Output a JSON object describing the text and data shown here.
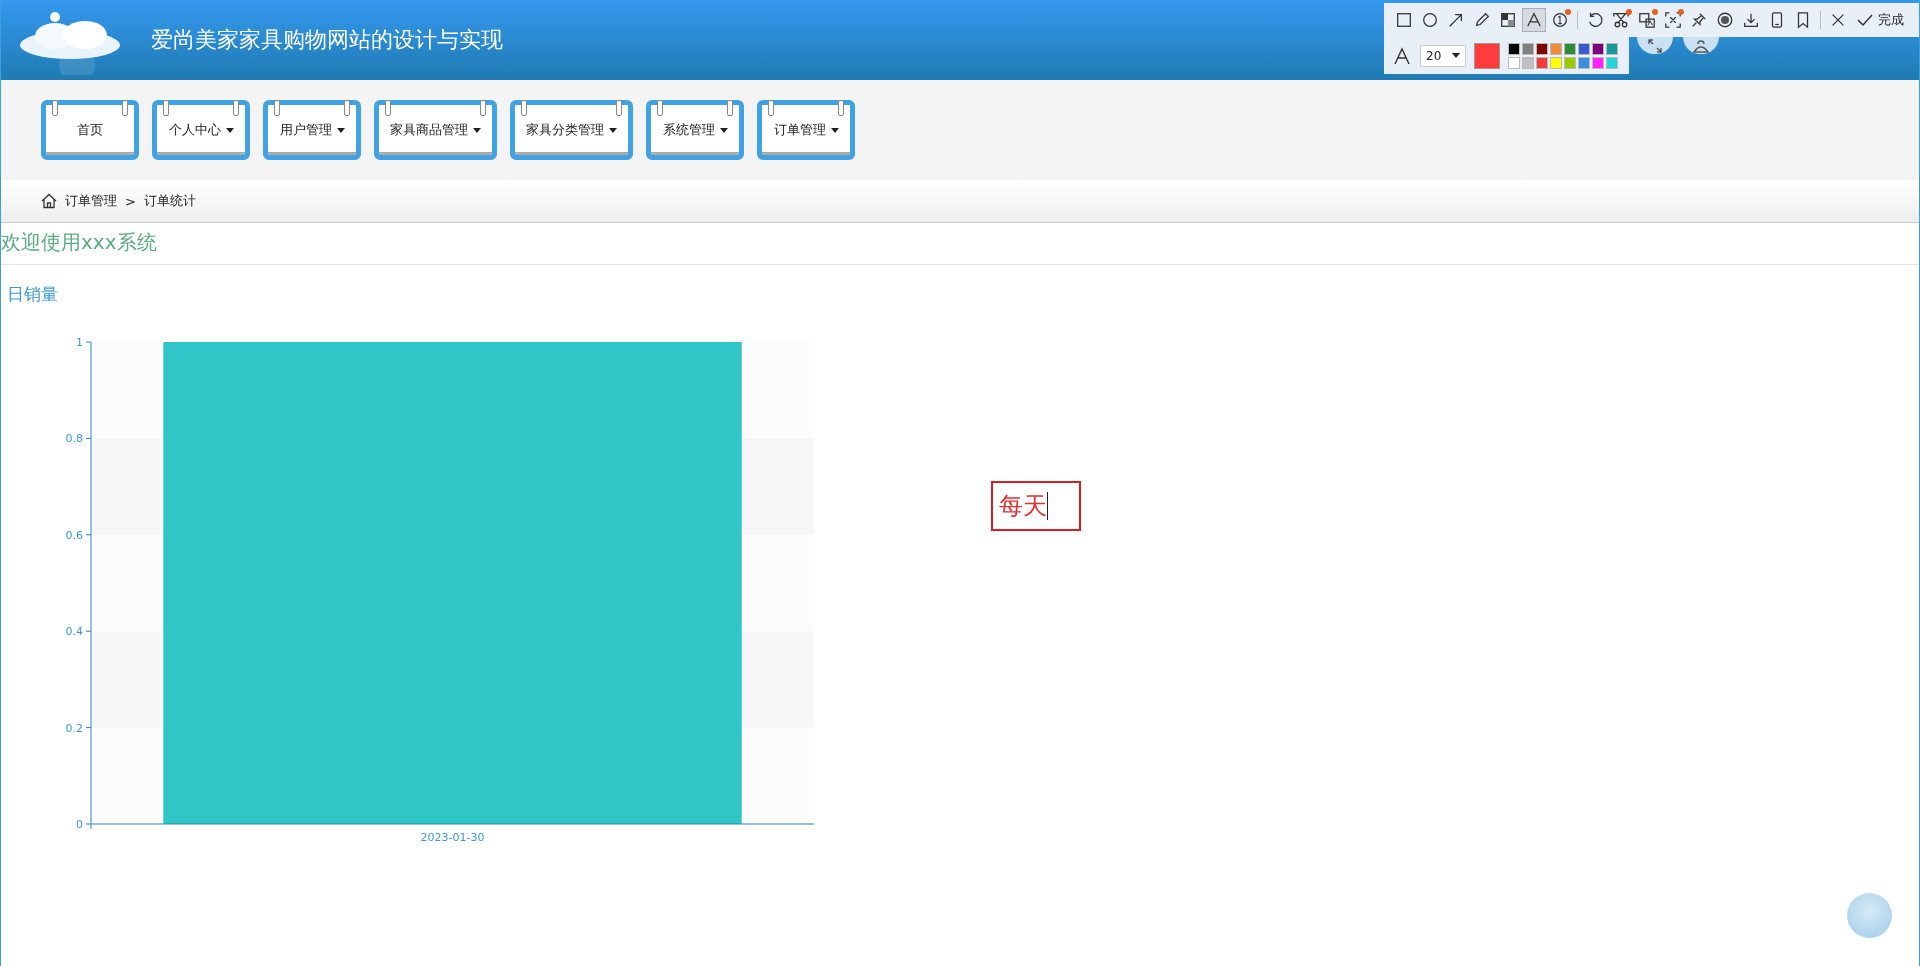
{
  "header": {
    "title": "爱尚美家家具购物网站的设计与实现"
  },
  "nav": [
    {
      "label": "首页",
      "has_menu": false
    },
    {
      "label": "个人中心",
      "has_menu": true
    },
    {
      "label": "用户管理",
      "has_menu": true
    },
    {
      "label": "家具商品管理",
      "has_menu": true
    },
    {
      "label": "家具分类管理",
      "has_menu": true
    },
    {
      "label": "系统管理",
      "has_menu": true
    },
    {
      "label": "订单管理",
      "has_menu": true
    }
  ],
  "breadcrumb": [
    "订单管理",
    ">",
    "订单统计"
  ],
  "welcome": "欢迎使用xxx系统",
  "chart_title": "日销量",
  "chart_data": {
    "type": "bar",
    "categories": [
      "2023-01-30"
    ],
    "values": [
      1
    ],
    "ylim": [
      0,
      1
    ],
    "yticks": [
      0,
      0.2,
      0.4,
      0.6,
      0.8,
      1
    ]
  },
  "annotation": {
    "text": "每天"
  },
  "capture_toolbar": {
    "tools": [
      {
        "selected": false,
        "badge": false
      },
      {
        "selected": false,
        "badge": false
      },
      {
        "selected": false,
        "badge": false
      },
      {
        "selected": false,
        "badge": false
      },
      {
        "selected": false,
        "badge": false
      },
      {
        "selected": true,
        "badge": false
      },
      {
        "selected": false,
        "badge": true
      },
      {
        "selected": false,
        "badge": false
      },
      {
        "selected": false,
        "badge": true
      },
      {
        "selected": false,
        "badge": true
      },
      {
        "selected": false,
        "badge": true
      },
      {
        "selected": false,
        "badge": false
      },
      {
        "selected": false,
        "badge": false
      },
      {
        "selected": false,
        "badge": false
      },
      {
        "selected": false,
        "badge": false
      },
      {
        "selected": false,
        "badge": false
      }
    ],
    "done_label": "完成",
    "font_size": "20",
    "current": {
      "color": "#ff3b3b"
    },
    "palette": [
      {
        "color": "#000000"
      },
      {
        "color": "#808080"
      },
      {
        "color": "#800000"
      },
      {
        "color": "#f28c38"
      },
      {
        "color": "#2e8b3a"
      },
      {
        "color": "#3a5bd0"
      },
      {
        "color": "#800080"
      },
      {
        "color": "#129a9a"
      },
      {
        "color": "#ffffff"
      },
      {
        "color": "#c0c0c0"
      },
      {
        "color": "#f03c3c"
      },
      {
        "color": "#ffff00"
      },
      {
        "color": "#99cc00"
      },
      {
        "color": "#3b8fe0"
      },
      {
        "color": "#ff22ff"
      },
      {
        "color": "#22d6d6"
      }
    ]
  }
}
